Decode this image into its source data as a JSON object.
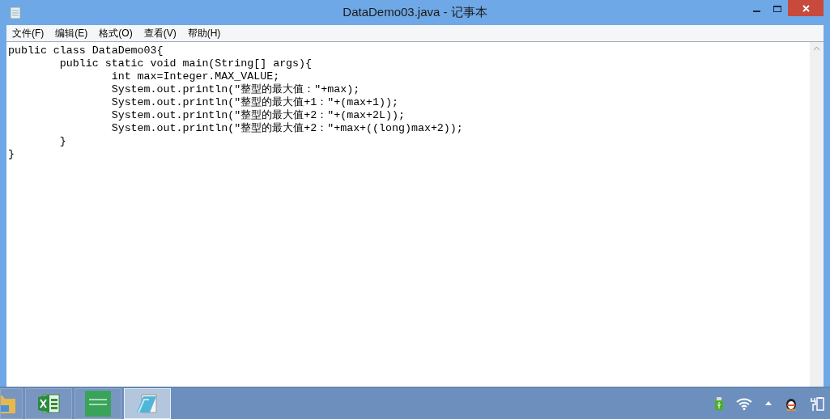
{
  "window": {
    "title": "DataDemo03.java - 记事本"
  },
  "menu": [
    "文件(F)",
    "编辑(E)",
    "格式(O)",
    "查看(V)",
    "帮助(H)"
  ],
  "editor": {
    "lines": [
      "public class DataDemo03{",
      "\tpublic static void main(String[] args){",
      "\t\tint max=Integer.MAX_VALUE;",
      "\t\tSystem.out.println(\"整型的最大值：\"+max);",
      "\t\tSystem.out.println(\"整型的最大值+1：\"+(max+1));",
      "\t\tSystem.out.println(\"整型的最大值+2：\"+(max+2L));",
      "\t\tSystem.out.println(\"整型的最大值+2：\"+max+((long)max+2));",
      "\t}",
      "}"
    ]
  },
  "taskbar": {
    "apps": [
      {
        "kind": "folder",
        "selected": false
      },
      {
        "kind": "spreadsheet",
        "selected": false
      },
      {
        "kind": "green-app",
        "selected": false
      },
      {
        "kind": "notepad",
        "selected": true
      }
    ],
    "tray": [
      {
        "kind": "usb"
      },
      {
        "kind": "wifi"
      },
      {
        "kind": "arrow"
      },
      {
        "kind": "penguin"
      },
      {
        "kind": "power"
      }
    ]
  }
}
